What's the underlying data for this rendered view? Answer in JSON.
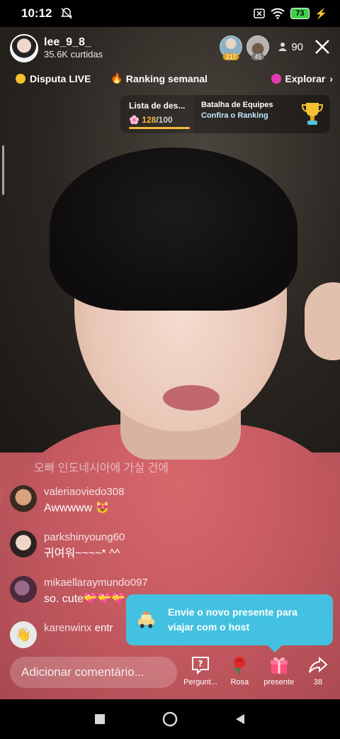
{
  "status": {
    "time": "10:12",
    "battery": "73"
  },
  "host": {
    "name": "lee_9_8_",
    "likes": "35.6K curtidas"
  },
  "viewers": [
    {
      "badge": "217"
    },
    {
      "badge": "45"
    }
  ],
  "viewer_count": "90",
  "nav": {
    "dispute": "Disputa LIVE",
    "ranking": "Ranking semanal",
    "explore": "Explorar"
  },
  "cards": {
    "list_title": "Lista de des...",
    "progress_value": "128",
    "progress_total": "/100",
    "battle_title": "Batalha de Equipes",
    "battle_sub": "Confira o Ranking"
  },
  "chat": {
    "faded_message": "오빠 인도네시아에 가실 건에",
    "messages": [
      {
        "user": "valeriaoviedo308",
        "text": "Awwwww 😻"
      },
      {
        "user": "parkshinyoung60",
        "text": "귀여워~~~~*  ^^"
      },
      {
        "user": "mikaellaraymundo097",
        "text": "so. cute💝💝💝"
      },
      {
        "user": "karenwinx",
        "text": "entr"
      }
    ]
  },
  "tooltip": {
    "text": "Envie o novo presente para viajar com o host"
  },
  "comment_placeholder": "Adicionar comentário...",
  "actions": [
    {
      "label": "Pergunt..."
    },
    {
      "label": "Rosa"
    },
    {
      "label": "presente"
    },
    {
      "label": "38"
    }
  ]
}
